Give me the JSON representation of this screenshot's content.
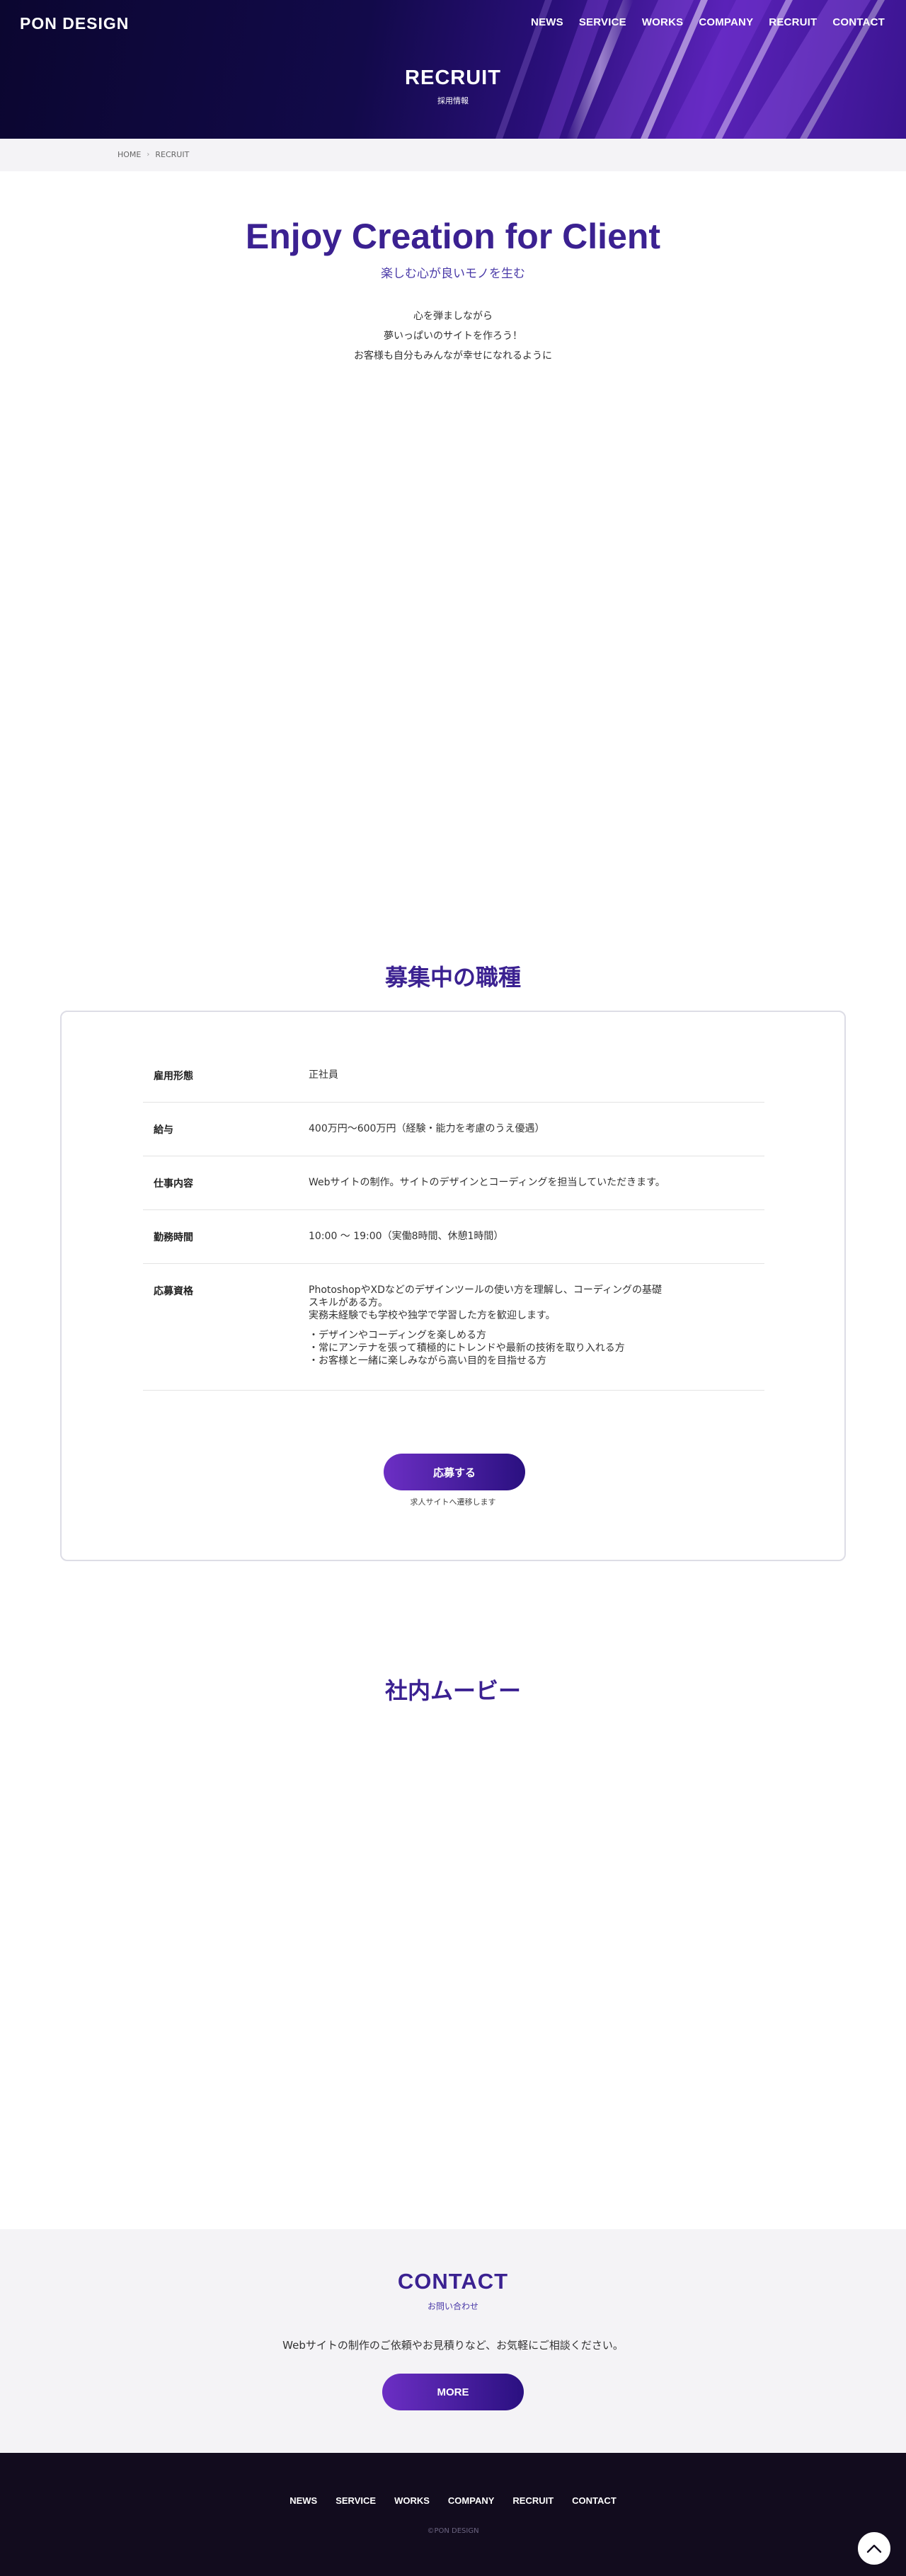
{
  "header": {
    "logo": "PON DESIGN",
    "nav": [
      "NEWS",
      "SERVICE",
      "WORKS",
      "COMPANY",
      "RECRUIT",
      "CONTACT"
    ],
    "title": "RECRUIT",
    "subtitle": "採用情報"
  },
  "breadcrumb": {
    "home": "HOME",
    "current": "RECRUIT"
  },
  "intro": {
    "title": "Enjoy Creation for Client",
    "subtitle": "楽しむ心が良いモノを生む",
    "lines": [
      "心を弾ましながら",
      "夢いっぱいのサイトを作ろう！",
      "お客様も自分もみんなが幸せになれるように"
    ]
  },
  "jobs": {
    "title": "募集中の職種",
    "rows": [
      {
        "label": "雇用形態",
        "value": "正社員"
      },
      {
        "label": "給与",
        "value": "400万円〜600万円（経験・能力を考慮のうえ優遇）"
      },
      {
        "label": "仕事内容",
        "value": "Webサイトの制作。サイトのデザインとコーディングを担当していただきます。"
      },
      {
        "label": "勤務時間",
        "value": "10:00 〜 19:00（実働8時間、休憩1時間）"
      }
    ],
    "qualification": {
      "label": "応募資格",
      "line1": "PhotoshopやXDなどのデザインツールの使い方を理解し、コーディングの基礎",
      "line2": "スキルがある方。",
      "line3": "実務未経験でも学校や独学で学習した方を歓迎します。",
      "bullets": [
        "・デザインやコーディングを楽しめる方",
        "・常にアンテナを張って積極的にトレンドや最新の技術を取り入れる方",
        "・お客様と一緒に楽しみながら高い目的を目指せる方"
      ]
    },
    "apply_label": "応募する",
    "apply_note": "求人サイトへ遷移します"
  },
  "movie": {
    "title": "社内ムービー"
  },
  "contact": {
    "title": "CONTACT",
    "subtitle": "お問い合わせ",
    "text": "Webサイトの制作のご依頼やお見積りなど、お気軽にご相談ください。",
    "more_label": "MORE"
  },
  "footer": {
    "nav": [
      "NEWS",
      "SERVICE",
      "WORKS",
      "COMPANY",
      "RECRUIT",
      "CONTACT"
    ],
    "copyright": "©PON DESIGN"
  },
  "icons": {
    "pagetop": "chevron-up-icon",
    "breadcrumb_sep": "chevron-right-icon"
  },
  "colors": {
    "accent": "#3b2191",
    "button_start": "#6c2fc4",
    "button_end": "#2a1080",
    "footer_bg": "#120c1e"
  }
}
